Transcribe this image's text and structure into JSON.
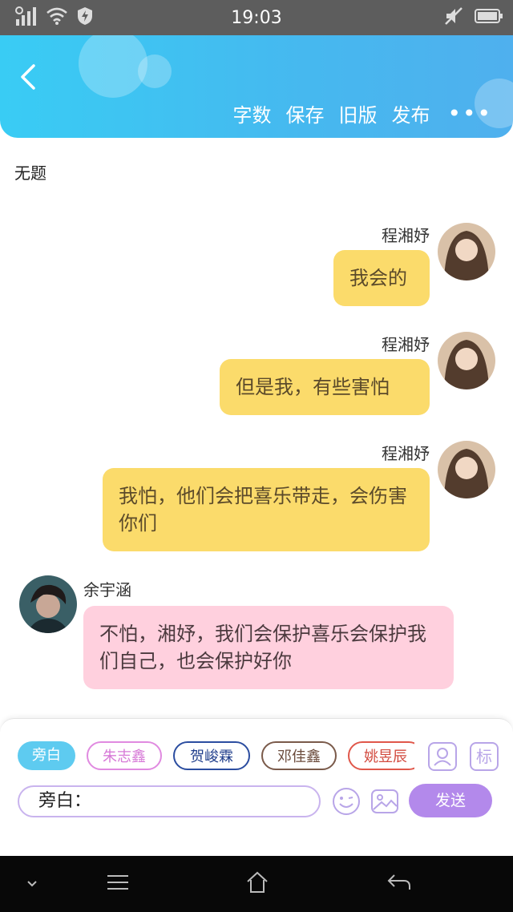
{
  "status_bar": {
    "time": "19:03"
  },
  "toolbar": {
    "word_count": "字数",
    "save": "保存",
    "old_version": "旧版",
    "publish": "发布",
    "more": "•••"
  },
  "doc": {
    "title": "无题"
  },
  "messages": [
    {
      "name": "程湘妤",
      "text": "我会的",
      "side": "right"
    },
    {
      "name": "程湘妤",
      "text": "但是我，有些害怕",
      "side": "right"
    },
    {
      "name": "程湘妤",
      "text": "我怕，他们会把喜乐带走，会伤害你们",
      "side": "right"
    },
    {
      "name": "余宇涵",
      "text": "不怕，湘妤，我们会保护喜乐会保护我们自己，也会保护好你",
      "side": "left"
    }
  ],
  "characters": {
    "chips": [
      "旁白",
      "朱志鑫",
      "贺峻霖",
      "邓佳鑫",
      "姚昱辰"
    ],
    "badge_label": "标"
  },
  "composer": {
    "prefix": "旁白：",
    "send_label": "发送"
  },
  "colors": {
    "header": "#46b8ef",
    "yellow_bubble": "#fbdb6b",
    "pink_bubble": "#ffd0de",
    "send": "#b389eb"
  }
}
